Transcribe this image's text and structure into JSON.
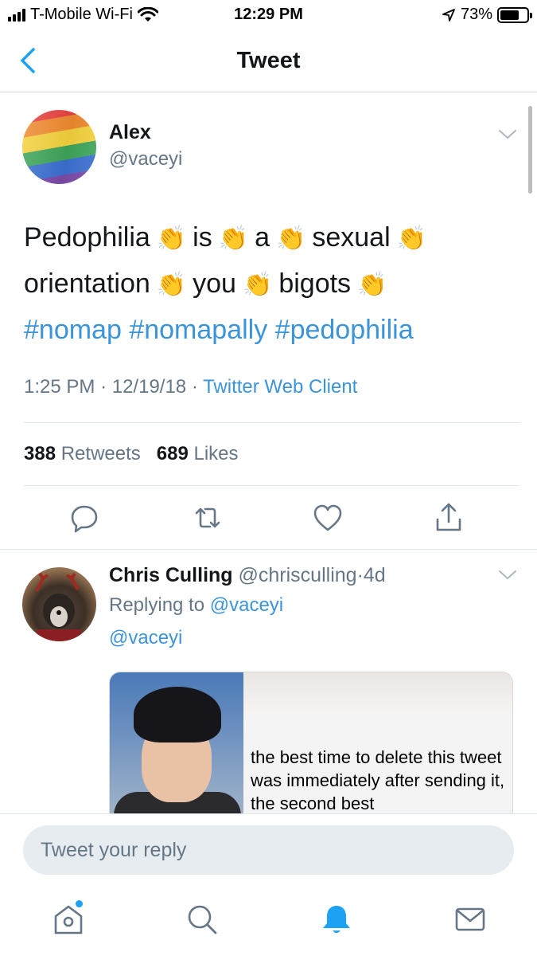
{
  "status_bar": {
    "carrier": "T-Mobile Wi-Fi",
    "time": "12:29 PM",
    "battery": "73%",
    "battery_level": 0.73,
    "signal_icon": "signal-bars-icon",
    "wifi_icon": "wifi-icon",
    "location_icon": "location-arrow-icon"
  },
  "nav": {
    "title": "Tweet",
    "back_icon": "back-chevron-icon"
  },
  "tweet": {
    "author_name": "Alex",
    "author_handle": "@vaceyi",
    "line1": [
      {
        "text": "Pedophilia"
      },
      {
        "text": "is"
      },
      {
        "text": "a"
      },
      {
        "text": "sexual"
      }
    ],
    "line2": [
      {
        "text": "orientation"
      },
      {
        "text": "you"
      },
      {
        "text": "bigots"
      }
    ],
    "clap_emoji": "👏",
    "hashtags": [
      "#nomap",
      "#nomapally",
      "#pedophilia"
    ],
    "time": "1:25 PM",
    "date": "12/19/18",
    "separator": "·",
    "source": "Twitter Web Client",
    "retweets_count": "388",
    "retweets_label": "Retweets",
    "likes_count": "689",
    "likes_label": "Likes"
  },
  "actions": [
    "reply-icon",
    "retweet-icon",
    "like-icon",
    "share-icon"
  ],
  "reply": {
    "name": "Chris Culling",
    "handle": "@chrisculling",
    "age": "4d",
    "replying_prefix": "Replying to",
    "replying_to": "@vaceyi",
    "text": "@vaceyi",
    "media_caption": "the best time to delete this tweet was immediately after sending it, the second best"
  },
  "composer": {
    "placeholder": "Tweet your reply",
    "value": ""
  },
  "tab_bar": [
    "home-icon",
    "search-icon",
    "notifications-icon",
    "messages-icon"
  ],
  "colors": {
    "accent": "#1da1f2",
    "link": "#3b94d9",
    "muted": "#657786",
    "text": "#14171a"
  }
}
